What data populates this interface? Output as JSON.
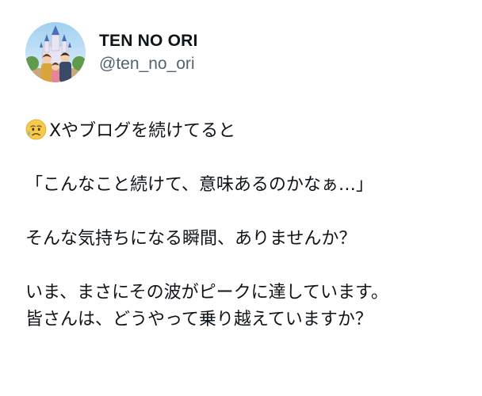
{
  "profile": {
    "display_name": "TEN NO ORI",
    "handle": "@ten_no_ori",
    "avatar_icon": "family-castle-avatar"
  },
  "tweet": {
    "emoji_icon": "sad-relieved-face-emoji",
    "lines": [
      "Xやブログを続けてると",
      "「こんなこと続けて、意味あるのかなぁ…」",
      "そんな気持ちになる瞬間、ありませんか？",
      "いま、まさにその波がピークに達しています。",
      "皆さんは、どうやって乗り越えていますか？"
    ]
  },
  "colors": {
    "text": "#0f1419",
    "secondary": "#536471",
    "background": "#ffffff"
  }
}
